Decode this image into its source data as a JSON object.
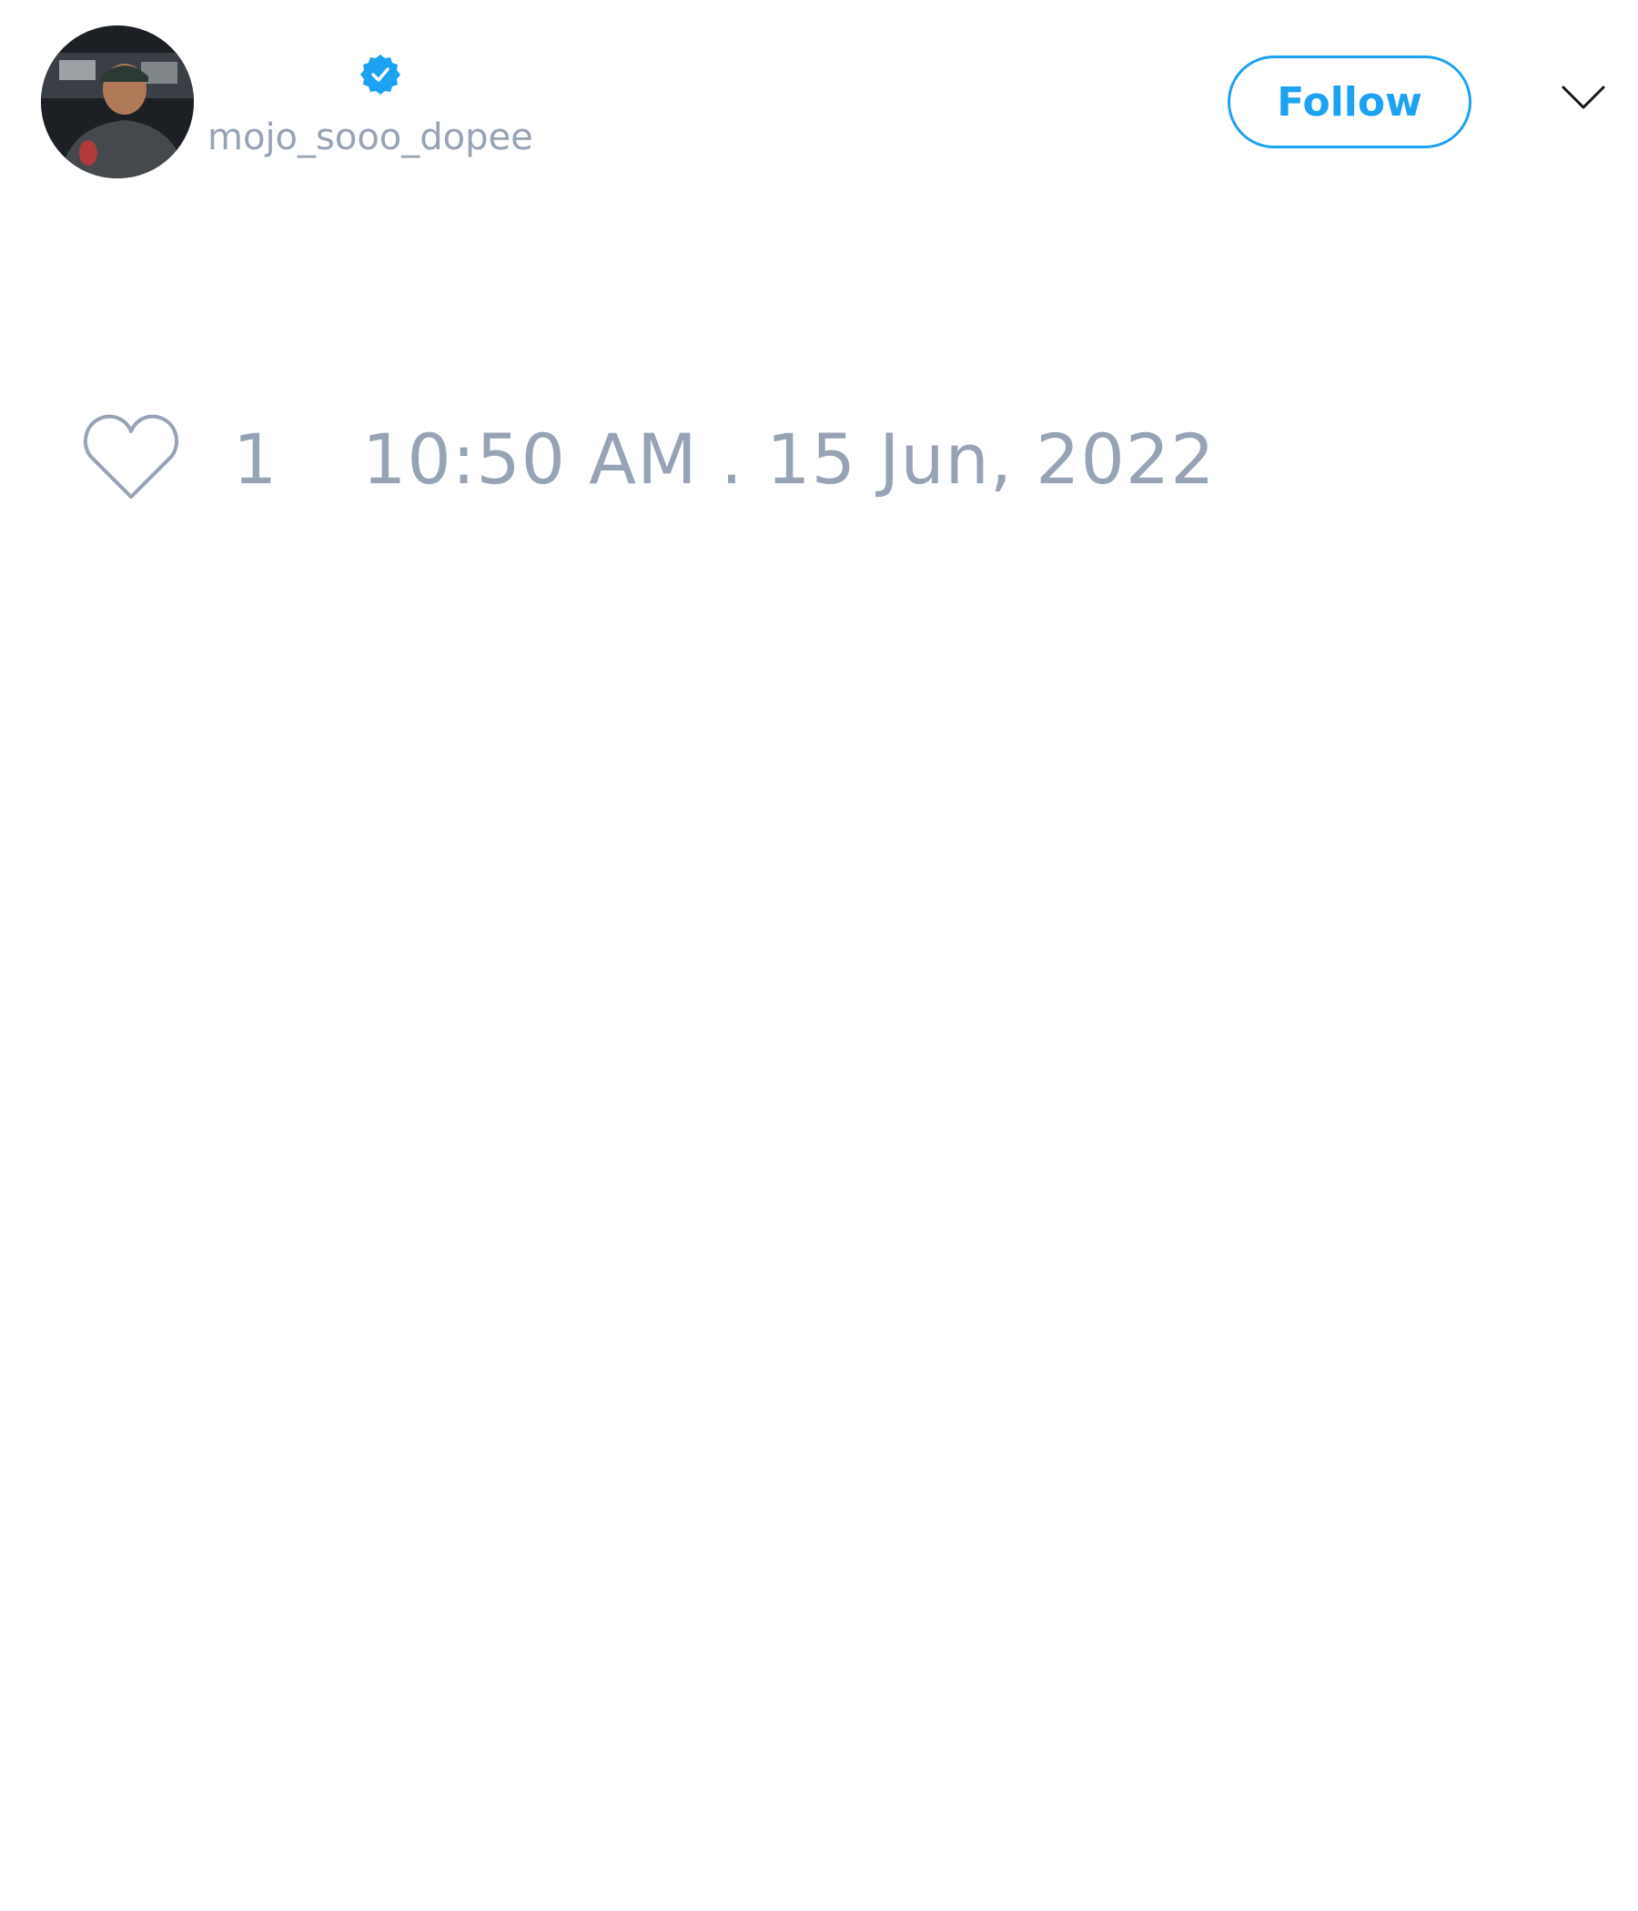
{
  "tweet": {
    "author": {
      "handle": "mojo_sooo_dopee",
      "avatar_icon": "avatar-photo",
      "verified_icon": "verified-badge-icon"
    },
    "follow_label": "Follow",
    "menu_icon": "chevron-down-icon",
    "like_icon": "heart-icon",
    "like_count": "1",
    "timestamp": "10:50 AM . 15 Jun, 2022"
  },
  "colors": {
    "accent": "#1da1f2",
    "muted_text": "#96a3b5",
    "background": "#ffffff"
  }
}
